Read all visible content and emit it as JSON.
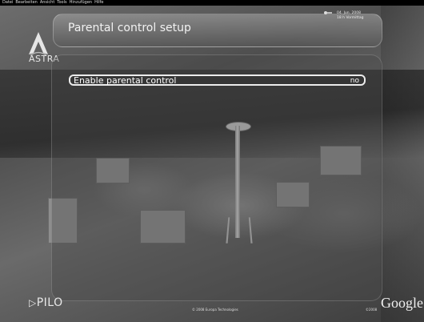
{
  "menu": {
    "items": [
      "Datei",
      "Bearbeiten",
      "Ansicht",
      "Tools",
      "Hinzufügen",
      "Hilfe"
    ]
  },
  "logo": {
    "text": "ASTRA"
  },
  "header": {
    "title": "Parental control setup"
  },
  "status": {
    "date": "04. Jun. 2008",
    "time": "18 h Vormittag"
  },
  "options": [
    {
      "label": "Enable parental control",
      "value": "no"
    }
  ],
  "footer": {
    "pilot_text": "PILO",
    "google_text": "Google",
    "copyright": "©2008",
    "bottom_info": "© 2008 Europa Technologies"
  },
  "colors": {
    "text": "#ffffff",
    "panel_border": "#ececec"
  }
}
